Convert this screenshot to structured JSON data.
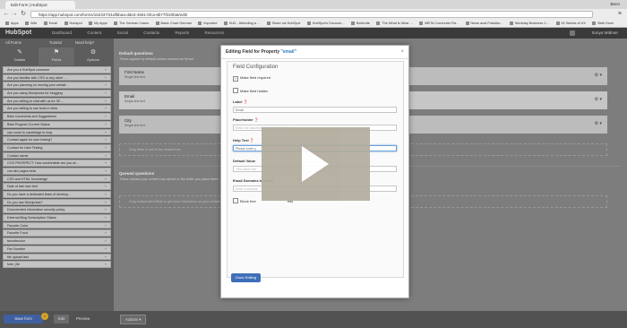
{
  "browser": {
    "tab_title": "Edit Form | HubSpot",
    "url": "https://app.hubspot.com/forms/162337/31dfbbaa-dde3-4591-bfca-8b77f220fa6/edit/",
    "profile_name": "Benn",
    "bookmarks": [
      "Apps",
      "Wiki",
      "Email",
      "Hubspot",
      "My Apps",
      "The German Cases",
      "Basic Chart German",
      "Imported",
      "HuG - Attending a ...",
      "Share via HubSpot",
      "HubSpot's Docume...",
      "Bekende",
      "The What is Wear ...",
      "MBTA Commuter Ra...",
      "News aust Frankfur...",
      "Workday Business C...",
      "52 Weeks of UX",
      "Beth Dunn"
    ]
  },
  "hubspot_bar": {
    "logo": "HubSpot",
    "nav": [
      "Dashboard",
      "Content",
      "Social",
      "Contacts",
      "Reports",
      "Resources"
    ],
    "user": "Sonya Widmer"
  },
  "sidebar": {
    "top_links": [
      "All Forms",
      "Tutorial",
      "Need help?"
    ],
    "tabs": [
      {
        "label": "Details",
        "icon": "pencil-icon"
      },
      {
        "label": "Fields",
        "icon": "flag-icon"
      },
      {
        "label": "Options",
        "icon": "gear-icon"
      }
    ],
    "questions": [
      "Are you a HubSpot customer",
      "Are you familiar with CSS or any other ...",
      "Are you planning on moving your websit...",
      "Are you using Wordpress for blogging",
      "Are you willing to chat with us for 30 ...",
      "Are you willing to use tools in beta",
      "Beta Comments and Suggestions",
      "Beta Program Current Status",
      "can come to cambridge in may",
      "Contact again for user testing?",
      "Contact for User Testing",
      "Contact owner",
      "COS PROSPECT: How comfortable are you wi...",
      "cos site pages beta",
      "CSS and HTML Knowledge",
      "Date of last user test",
      "Do you have a dedicated team of develop...",
      "Do you use Wordpress?",
      "Documented information security policy",
      "External Blog Subscription Status",
      "Favorite Color",
      "Favorite Food",
      "favoritecolor",
      "Fax Number",
      "file upload test",
      "form_file"
    ]
  },
  "main": {
    "default_title": "Default questions",
    "default_desc": "These appear by default unless marked as Smart",
    "fields": [
      {
        "name": "First Name",
        "help": "Single-line text"
      },
      {
        "name": "Email",
        "help": "Single-line text"
      },
      {
        "name": "City",
        "help": "Single-line text"
      }
    ],
    "drop_text_default": "Drag fields in and to the default form",
    "queued_title": "Queued questions",
    "queued_desc": "These replace your smart rows above in the order you place them",
    "drop_text_queued": "Drag independent fields to get more information on your contacts over time"
  },
  "footer": {
    "save_label": "Save form",
    "save_badge": "1",
    "edit_tab": "Edit",
    "preview_tab": "Preview",
    "actions_label": "Actions"
  },
  "modal": {
    "title_prefix": "Editing Field for Property",
    "property": "\"email\"",
    "config_title": "Field Configuration",
    "make_required": "Make field required",
    "make_hidden": "Make field hidden",
    "label_label": "Label",
    "label_value": "Email",
    "placeholder_label": "Placeholder",
    "placeholder_value": "Enter the placeholder text for this field",
    "helptext_label": "Help Text",
    "helptext_value": "Please enter y",
    "default_value_label": "Default Value",
    "default_value_placeholder": "This value will",
    "email_domains_label": "Email Domains to block",
    "email_domains_placeholder": "Enter a comma",
    "block_free_label": "Block free",
    "block_free_tail": "ess",
    "done_label": "Done Editing"
  }
}
